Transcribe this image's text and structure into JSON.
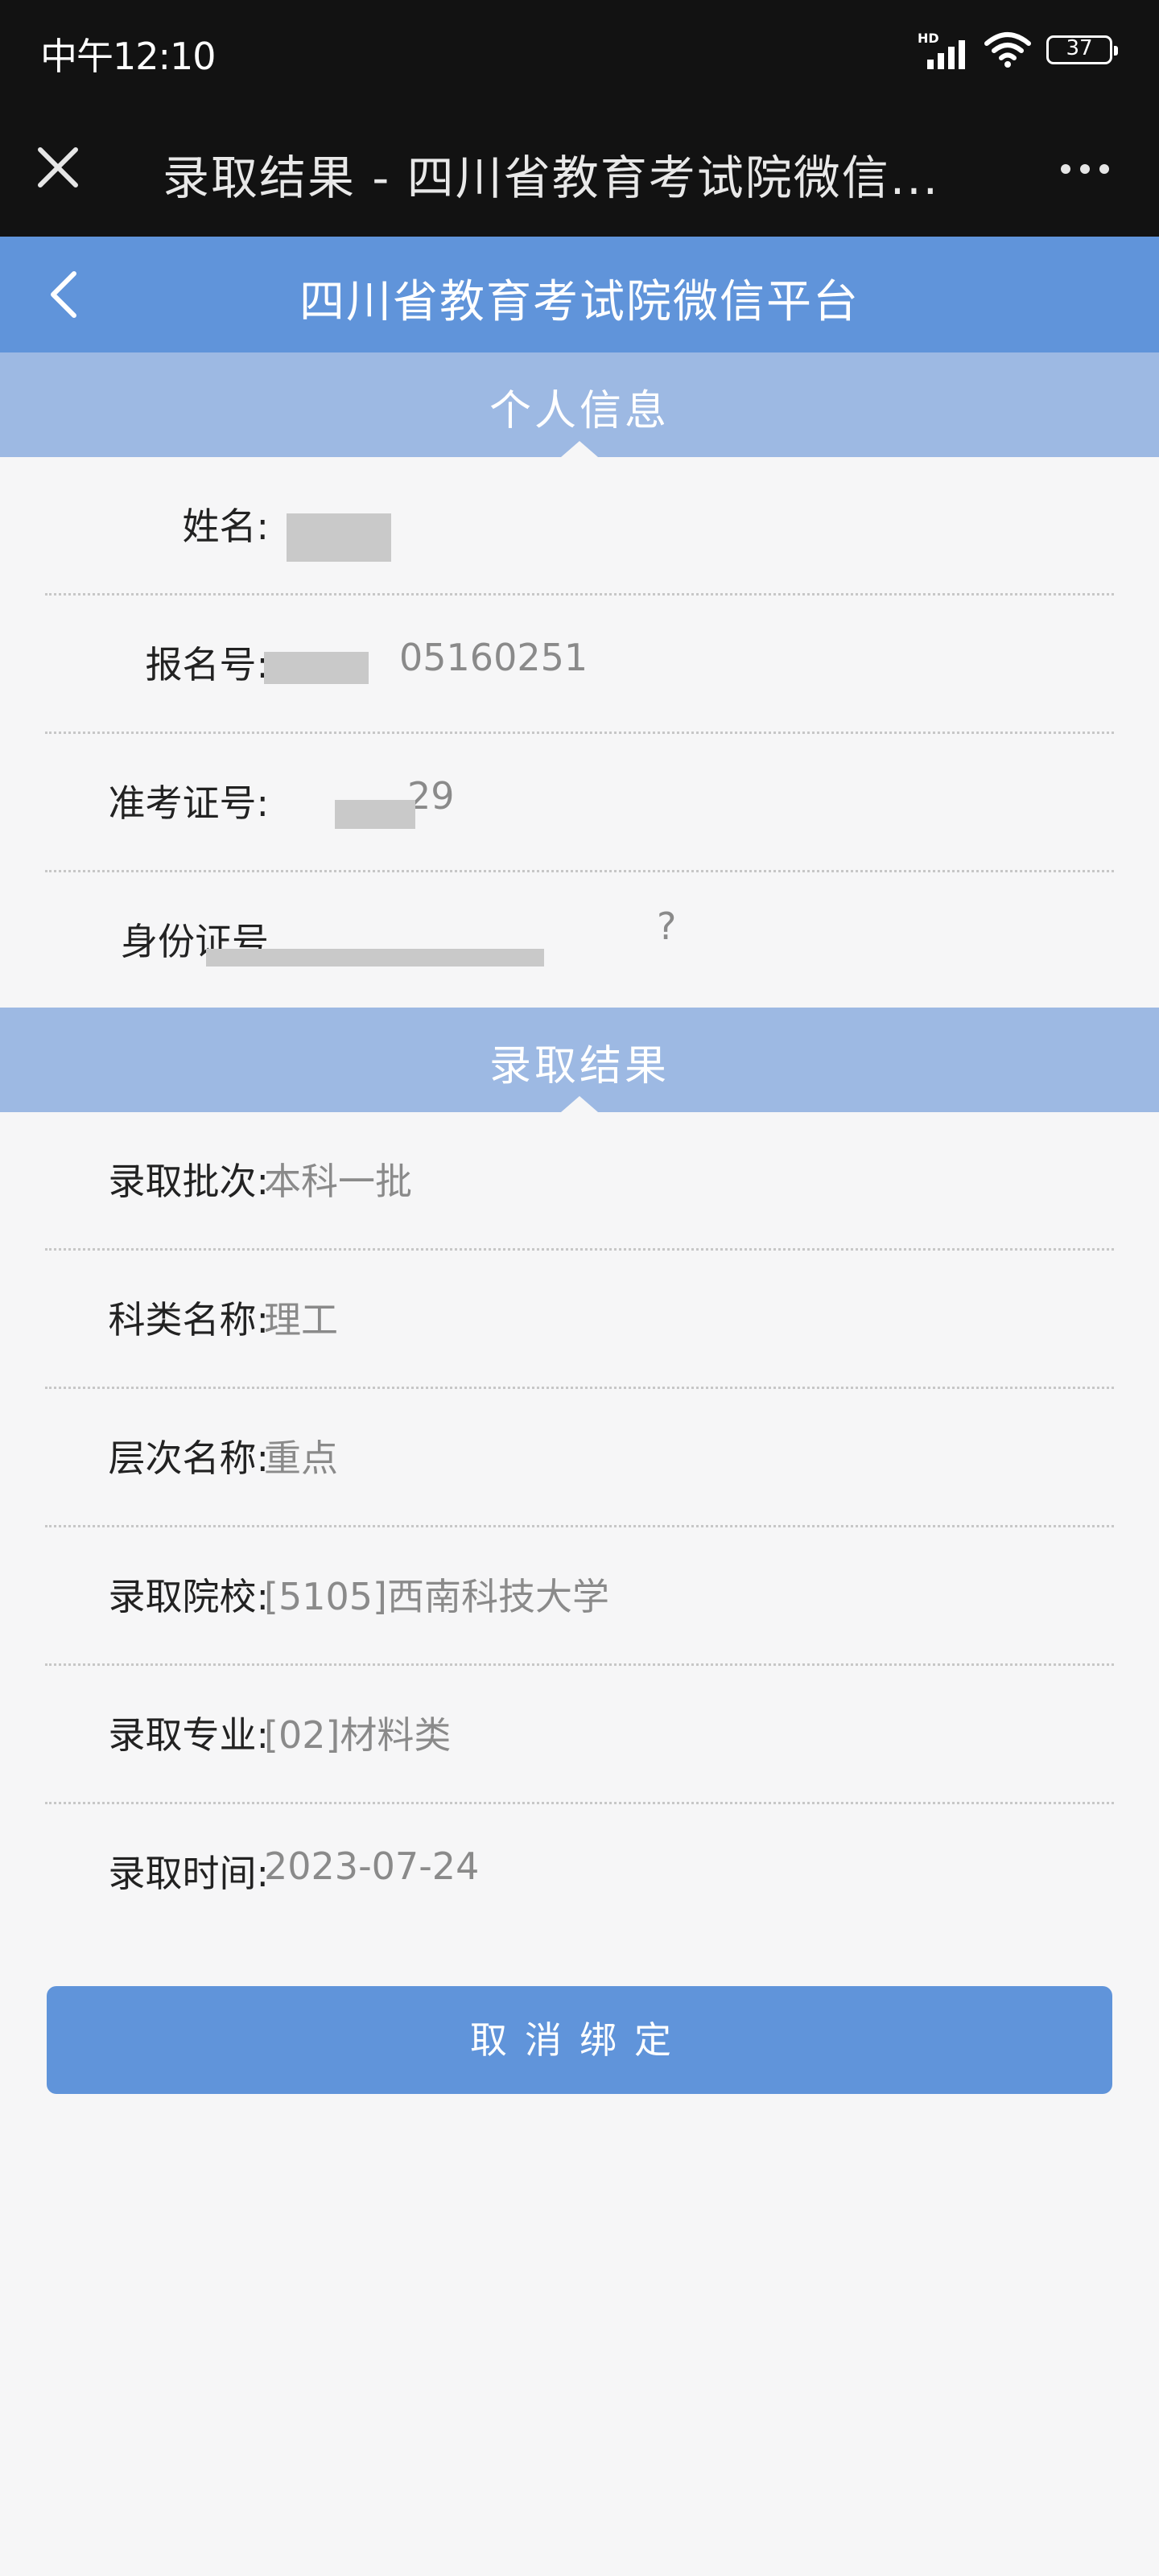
{
  "status_bar": {
    "time": "中午12:10",
    "battery": "37",
    "signal_tag": "HD"
  },
  "wechat_bar": {
    "title": "录取结果 - 四川省教育考试院微信..."
  },
  "app": {
    "title": "四川省教育考试院微信平台"
  },
  "personal": {
    "title": "个人信息",
    "name_label": "姓名:",
    "name_value": "",
    "reg_label": "报名号:",
    "reg_value": "05160251",
    "ticket_label": "准考证号:",
    "ticket_value": "29",
    "id_label": "身份证号",
    "id_value": "?"
  },
  "admission": {
    "title": "录取结果",
    "rows": [
      {
        "label": "录取批次:",
        "value": "本科一批"
      },
      {
        "label": "科类名称:",
        "value": "理工"
      },
      {
        "label": "层次名称:",
        "value": "重点"
      },
      {
        "label": "录取院校:",
        "value": "[5105]西南科技大学"
      },
      {
        "label": "录取专业:",
        "value": "[02]材料类"
      },
      {
        "label": "录取时间:",
        "value": "2023-07-24"
      }
    ]
  },
  "unbind_button": "取消绑定"
}
